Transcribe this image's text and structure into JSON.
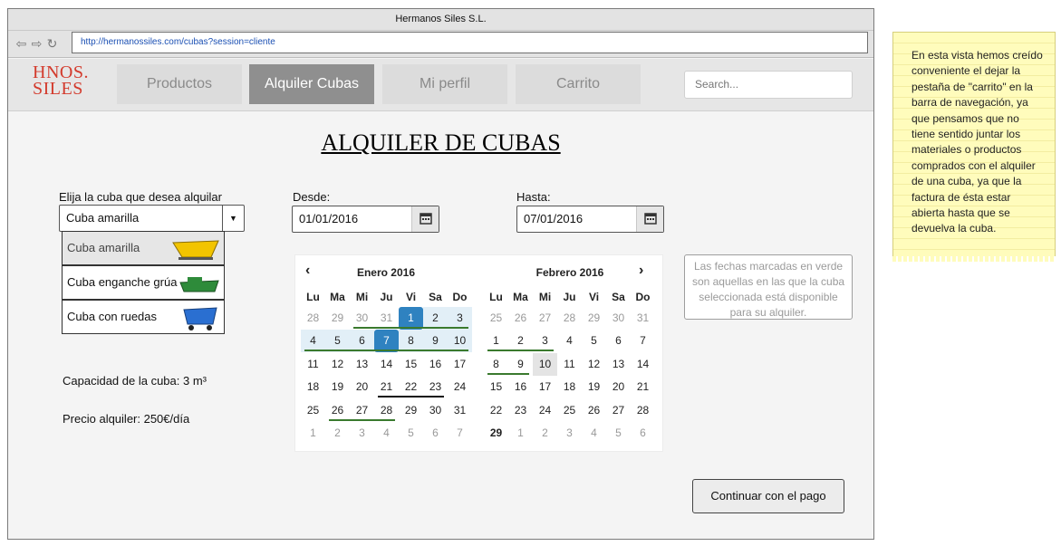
{
  "browser": {
    "title": "Hermanos Siles S.L.",
    "url": "http://hermanossiles.com/cubas?session=cliente"
  },
  "header": {
    "logo_line1": "HNOS.",
    "logo_line2": "SILES",
    "nav": [
      "Productos",
      "Alquiler Cubas",
      "Mi perfil",
      "Carrito"
    ],
    "active_nav": "Alquiler Cubas",
    "search_placeholder": "Search..."
  },
  "main": {
    "title": "ALQUILER DE CUBAS",
    "select_label": "Elija la cuba que desea alquilar",
    "selected_option": "Cuba amarilla",
    "options": [
      "Cuba amarilla",
      "Cuba enganche grúa",
      "Cuba con ruedas"
    ],
    "desde_label": "Desde:",
    "desde_value": "01/01/2016",
    "hasta_label": "Hasta:",
    "hasta_value": "07/01/2016",
    "capacity": "Capacidad de la cuba: 3 m³",
    "price": "Precio alquiler: 250€/día",
    "availability_note": "Las fechas marcadas en verde son aquellas en las que la cuba seleccionada está disponible para su alquiler.",
    "pay_button": "Continuar con el pago"
  },
  "calendar": {
    "month_left": "Enero 2016",
    "month_right": "Febrero 2016",
    "weekdays": [
      "Lu",
      "Ma",
      "Mi",
      "Ju",
      "Vi",
      "Sa",
      "Do"
    ],
    "left_days": [
      [
        "28",
        "29",
        "30",
        "31",
        "1",
        "2",
        "3"
      ],
      [
        "4",
        "5",
        "6",
        "7",
        "8",
        "9",
        "10"
      ],
      [
        "11",
        "12",
        "13",
        "14",
        "15",
        "16",
        "17"
      ],
      [
        "18",
        "19",
        "20",
        "21",
        "22",
        "23",
        "24"
      ],
      [
        "25",
        "26",
        "27",
        "28",
        "29",
        "30",
        "31"
      ],
      [
        "1",
        "2",
        "3",
        "4",
        "5",
        "6",
        "7"
      ]
    ],
    "right_days": [
      [
        "25",
        "26",
        "27",
        "28",
        "29",
        "30",
        "31"
      ],
      [
        "1",
        "2",
        "3",
        "4",
        "5",
        "6",
        "7"
      ],
      [
        "8",
        "9",
        "10",
        "11",
        "12",
        "13",
        "14"
      ],
      [
        "15",
        "16",
        "17",
        "18",
        "19",
        "20",
        "21"
      ],
      [
        "22",
        "23",
        "24",
        "25",
        "26",
        "27",
        "28"
      ],
      [
        "29",
        "1",
        "2",
        "3",
        "4",
        "5",
        "6"
      ]
    ]
  },
  "sticky_note": "En esta vista hemos creído conveniente el dejar la pestaña de \"carrito\" en la barra de navegación, ya que pensamos que no tiene sentido juntar los materiales o productos comprados con el alquiler de una cuba, ya que la factura de ésta estar abierta hasta que se devuelva la cuba.",
  "colors": {
    "brand": "#d33a2c",
    "active_tab": "#8f8f8f",
    "selected_day": "#2f82c0",
    "range_day": "#e2eff7",
    "available_line": "#3a7a2e"
  }
}
